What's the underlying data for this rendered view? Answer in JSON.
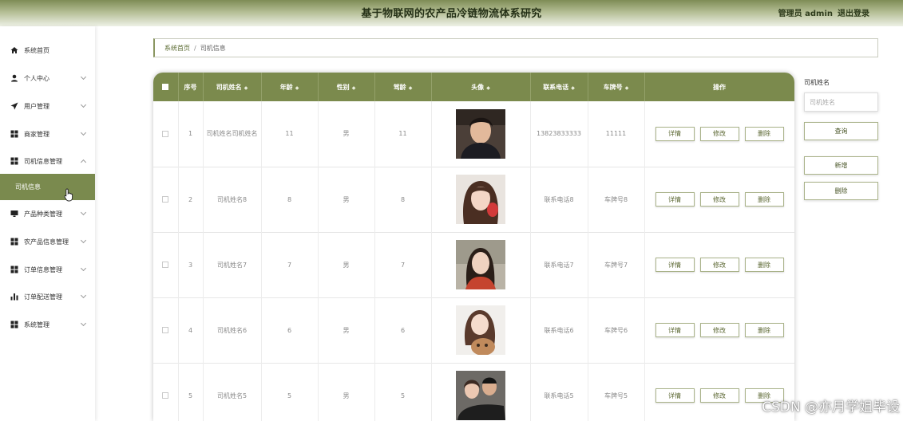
{
  "header": {
    "title": "基于物联网的农产品冷链物流体系研究",
    "user_label": "管理员 admin",
    "logout_label": "退出登录"
  },
  "sidebar": {
    "items": [
      {
        "label": "系统首页",
        "icon": "home-icon"
      },
      {
        "label": "个人中心",
        "icon": "user-icon"
      },
      {
        "label": "用户管理",
        "icon": "send-icon"
      },
      {
        "label": "商家管理",
        "icon": "grid-icon"
      },
      {
        "label": "司机信息管理",
        "icon": "grid-icon"
      },
      {
        "label": "产品种类管理",
        "icon": "monitor-icon"
      },
      {
        "label": "农产品信息管理",
        "icon": "grid-icon"
      },
      {
        "label": "订单信息管理",
        "icon": "grid-icon"
      },
      {
        "label": "订单配送管理",
        "icon": "bar-chart-icon"
      },
      {
        "label": "系统管理",
        "icon": "grid-icon"
      }
    ],
    "active_sub": "司机信息"
  },
  "breadcrumb": {
    "home": "系统首页",
    "separator": "/",
    "current": "司机信息"
  },
  "table": {
    "headers": [
      "序号",
      "司机姓名",
      "年龄",
      "性别",
      "驾龄",
      "头像",
      "联系电话",
      "车牌号",
      "操作"
    ],
    "rows": [
      {
        "index": "1",
        "name": "司机姓名司机姓名",
        "age": "11",
        "gender": "男",
        "driving_years": "11",
        "phone": "13823833333",
        "plate": "11111"
      },
      {
        "index": "2",
        "name": "司机姓名8",
        "age": "8",
        "gender": "男",
        "driving_years": "8",
        "phone": "联系电话8",
        "plate": "车牌号8"
      },
      {
        "index": "3",
        "name": "司机姓名7",
        "age": "7",
        "gender": "男",
        "driving_years": "7",
        "phone": "联系电话7",
        "plate": "车牌号7"
      },
      {
        "index": "4",
        "name": "司机姓名6",
        "age": "6",
        "gender": "男",
        "driving_years": "6",
        "phone": "联系电话6",
        "plate": "车牌号6"
      },
      {
        "index": "5",
        "name": "司机姓名5",
        "age": "5",
        "gender": "男",
        "driving_years": "5",
        "phone": "联系电话5",
        "plate": "车牌号5"
      }
    ],
    "actions": {
      "detail": "详情",
      "edit": "修改",
      "delete": "删除"
    }
  },
  "search": {
    "label": "司机姓名",
    "placeholder": "司机姓名",
    "query_button": "查询",
    "add_button": "新增",
    "delete_button": "删除"
  },
  "watermark": "CSDN @亦月学姐毕设",
  "colors": {
    "accent": "#7b8a4d",
    "header_dark": "#7e8c55"
  }
}
